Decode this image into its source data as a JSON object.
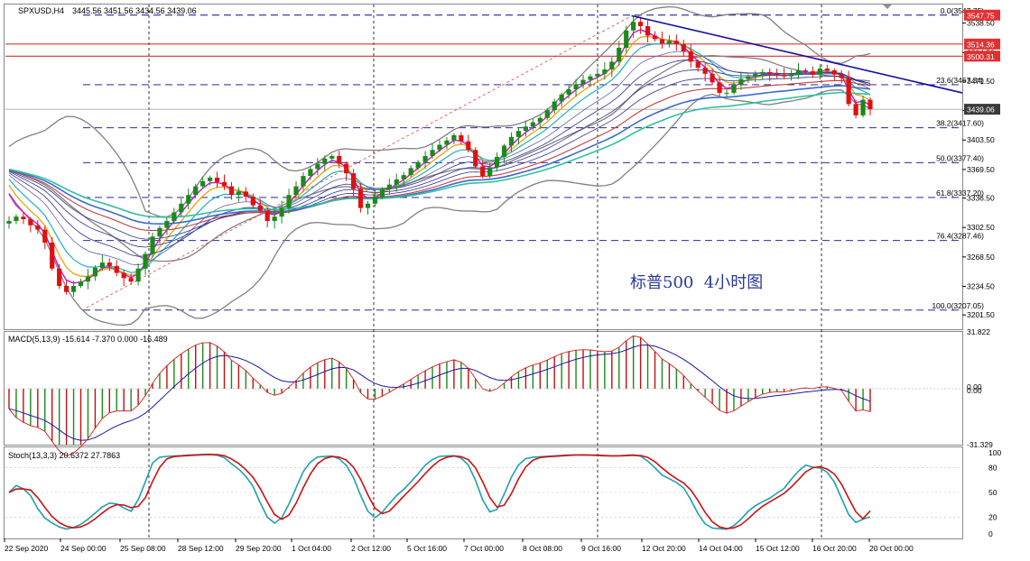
{
  "window": {
    "symbol": "SPXUSD,H4",
    "ohlc": "3445.56 3451.56 3434.56 3439.06"
  },
  "annotation": "标普500  4小时图",
  "colors": {
    "bull": "#1a8a1a",
    "bear": "#e01010",
    "fib": "#0a0a8a",
    "hline": "#e23030",
    "trend": "#1010a0",
    "bb": "#808080",
    "macd_signal": "#1a1aa0",
    "macd_line": "#d02020",
    "stoch_main": "#20a0b0",
    "stoch_signal": "#d01010",
    "current": "#3a3a3a"
  },
  "chart_data": [
    {
      "type": "candlestick",
      "title": "SPXUSD,H4 3445.56 3451.56 3434.56 3439.06",
      "price_range": [
        3185,
        3560
      ],
      "y_ticks": [
        3201.5,
        3234.5,
        3268.5,
        3302.5,
        3336.5,
        3369.5,
        3403.5,
        3437.5,
        3471.5,
        3504.5,
        3538.5
      ],
      "x_ticks": [
        "22 Sep 2020",
        "24 Sep 00:00",
        "25 Sep 08:00",
        "28 Sep 12:00",
        "29 Sep 20:00",
        "1 Oct 04:00",
        "2 Oct 12:00",
        "5 Oct 16:00",
        "7 Oct 00:00",
        "8 Oct 08:00",
        "9 Oct 16:00",
        "12 Oct 20:00",
        "14 Oct 04:00",
        "15 Oct 12:00",
        "16 Oct 20:00",
        "20 Oct 00:00"
      ],
      "close_series": [
        3310,
        3315,
        3312,
        3305,
        3300,
        3285,
        3255,
        3235,
        3228,
        3235,
        3240,
        3246,
        3256,
        3262,
        3258,
        3250,
        3244,
        3240,
        3255,
        3272,
        3292,
        3302,
        3310,
        3320,
        3330,
        3340,
        3350,
        3356,
        3360,
        3355,
        3350,
        3340,
        3344,
        3338,
        3328,
        3322,
        3310,
        3315,
        3325,
        3340,
        3350,
        3362,
        3370,
        3376,
        3382,
        3385,
        3376,
        3365,
        3347,
        3325,
        3330,
        3338,
        3347,
        3352,
        3358,
        3363,
        3371,
        3378,
        3385,
        3392,
        3398,
        3403,
        3409,
        3402,
        3392,
        3373,
        3362,
        3372,
        3384,
        3397,
        3407,
        3414,
        3419,
        3424,
        3429,
        3438,
        3448,
        3456,
        3462,
        3468,
        3473,
        3477,
        3480,
        3485,
        3494,
        3510,
        3530,
        3540,
        3535,
        3524,
        3520,
        3515,
        3518,
        3514,
        3506,
        3494,
        3487,
        3480,
        3470,
        3458,
        3458,
        3467,
        3474,
        3477,
        3480,
        3482,
        3480,
        3479,
        3477,
        3480,
        3484,
        3483,
        3479,
        3486,
        3484,
        3479,
        3475,
        3445,
        3432,
        3450,
        3439.06
      ],
      "horizontal_lines": [
        3514.36,
        3500.31
      ],
      "price_labels": {
        "high": "3547.75",
        "r1": "3514.36",
        "r2": "3500.31",
        "current": "3439.06"
      },
      "fibonacci": [
        {
          "label": "0.0(3547.75)",
          "price": 3547.75
        },
        {
          "label": "23.6(3467.34)",
          "price": 3467.34
        },
        {
          "label": "38.2(3417.60)",
          "price": 3417.6
        },
        {
          "label": "50.0(3377.40)",
          "price": 3377.4
        },
        {
          "label": "61.8(3337.20)",
          "price": 3337.2
        },
        {
          "label": "76.4(3287.46)",
          "price": 3287.46
        },
        {
          "label": "100.0(3207.05)",
          "price": 3207.05
        }
      ],
      "indicators": [
        "Bollinger Bands",
        "Moving average ribbon",
        "Descending trendline"
      ]
    },
    {
      "type": "bar+line",
      "title": "MACD(5,13,9) -15.614 -7.370 0.000 -16.489",
      "ylim": [
        -31.329,
        31.822
      ],
      "y_ticks": [
        "31.822",
        "0.00",
        "0.00",
        "-31.329"
      ]
    },
    {
      "type": "line",
      "title": "Stoch(13,3,3) 20.6372 27.7863",
      "ylim": [
        0,
        100
      ],
      "y_ticks": [
        "100",
        "80",
        "50",
        "20",
        "0"
      ],
      "series_values": {
        "main": 20.6372,
        "signal": 27.7863
      }
    }
  ]
}
